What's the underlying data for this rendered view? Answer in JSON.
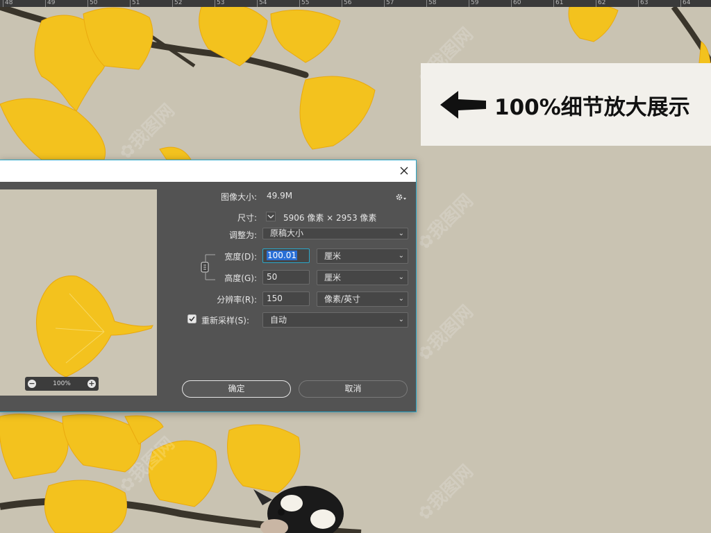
{
  "ruler": {
    "ticks": [
      "48",
      "49",
      "50",
      "51",
      "52",
      "53",
      "54",
      "55",
      "56",
      "57",
      "58",
      "59",
      "60",
      "61",
      "62",
      "63",
      "64"
    ]
  },
  "banner": {
    "text": "100%细节放大展示"
  },
  "dialog": {
    "image_size_label": "图像大小:",
    "image_size_value": "49.9M",
    "dimensions_label": "尺寸:",
    "dimensions_value": "5906 像素 × 2953 像素",
    "fit_to_label": "调整为:",
    "fit_to_value": "原稿大小",
    "width_label": "宽度(D):",
    "width_value": "100.01",
    "width_unit": "厘米",
    "height_label": "高度(G):",
    "height_value": "50",
    "height_unit": "厘米",
    "resolution_label": "分辨率(R):",
    "resolution_value": "150",
    "resolution_unit": "像素/英寸",
    "resample_label": "重新采样(S):",
    "resample_checked": true,
    "resample_value": "自动",
    "ok_label": "确定",
    "cancel_label": "取消",
    "zoom_level": "100%"
  },
  "colors": {
    "canvas": "#c9c3b2",
    "dialog_bg": "#535353",
    "accent_border": "#2aa6c8",
    "selection": "#2a6fd6",
    "ginkgo_yellow": "#f5c21b",
    "banner_bg": "#f2f0eb"
  }
}
